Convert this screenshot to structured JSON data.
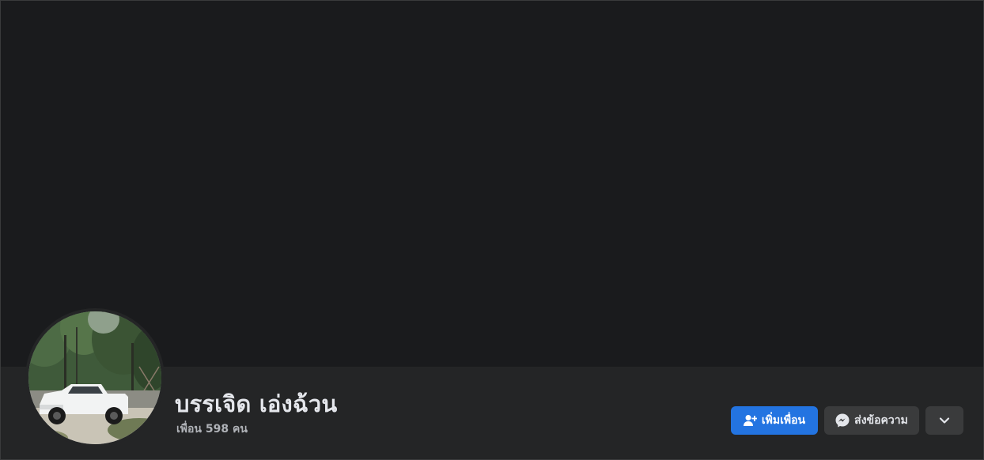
{
  "profile": {
    "name": "บรรเจิด เอ่งฉ้วน",
    "friends_count": "เพื่อน 598 คน"
  },
  "actions": {
    "add_friend_label": "เพิ่มเพื่อน",
    "message_label": "ส่งข้อความ",
    "more_icon": "chevron-down-icon"
  },
  "colors": {
    "primary_button": "#2374e1",
    "secondary_button": "#3a3b3c",
    "cover": "#1a1b1d",
    "profile_bar": "#242526",
    "name_text": "#e4e6eb",
    "muted_text": "#b0b3b8"
  }
}
